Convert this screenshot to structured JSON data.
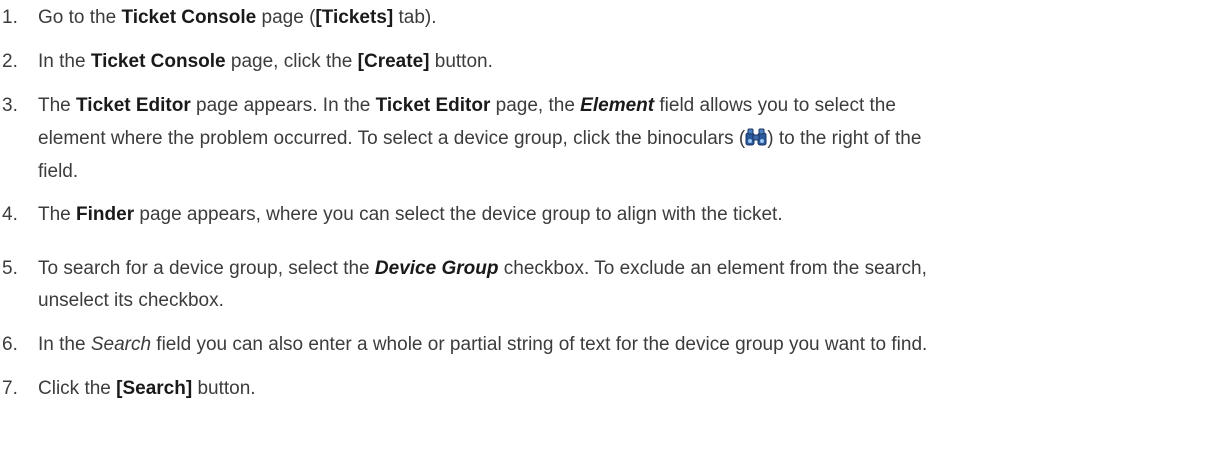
{
  "steps": [
    {
      "num": "1.",
      "parts": [
        "Go to the ",
        "Ticket Console",
        " page (",
        "[Tickets]",
        " tab)."
      ]
    },
    {
      "num": "2.",
      "parts": [
        "In the ",
        "Ticket Console",
        " page, click the ",
        "[Create]",
        " button."
      ]
    },
    {
      "num": "3.",
      "parts": [
        "The ",
        "Ticket Editor",
        " page appears. In the ",
        "Ticket Editor",
        " page, the ",
        "Element",
        " field allows you to select the",
        "element where the problem occurred. To select a device group, click the binoculars (",
        ") to the right of the",
        "field."
      ]
    },
    {
      "num": "4.",
      "parts": [
        "The ",
        "Finder",
        " page appears, where you can select the device group to align with the ticket."
      ]
    },
    {
      "num": "5.",
      "parts": [
        "To search for a device group, select the ",
        "Device Group",
        " checkbox. To exclude an element from the search,",
        "unselect its checkbox."
      ]
    },
    {
      "num": "6.",
      "parts": [
        "In the ",
        "Search",
        " field you can also enter a whole or partial string of text for the device group you want to find."
      ]
    },
    {
      "num": "7.",
      "parts": [
        "Click the ",
        "[Search]",
        " button."
      ]
    }
  ],
  "icons": {
    "binoculars": "binoculars-icon"
  }
}
